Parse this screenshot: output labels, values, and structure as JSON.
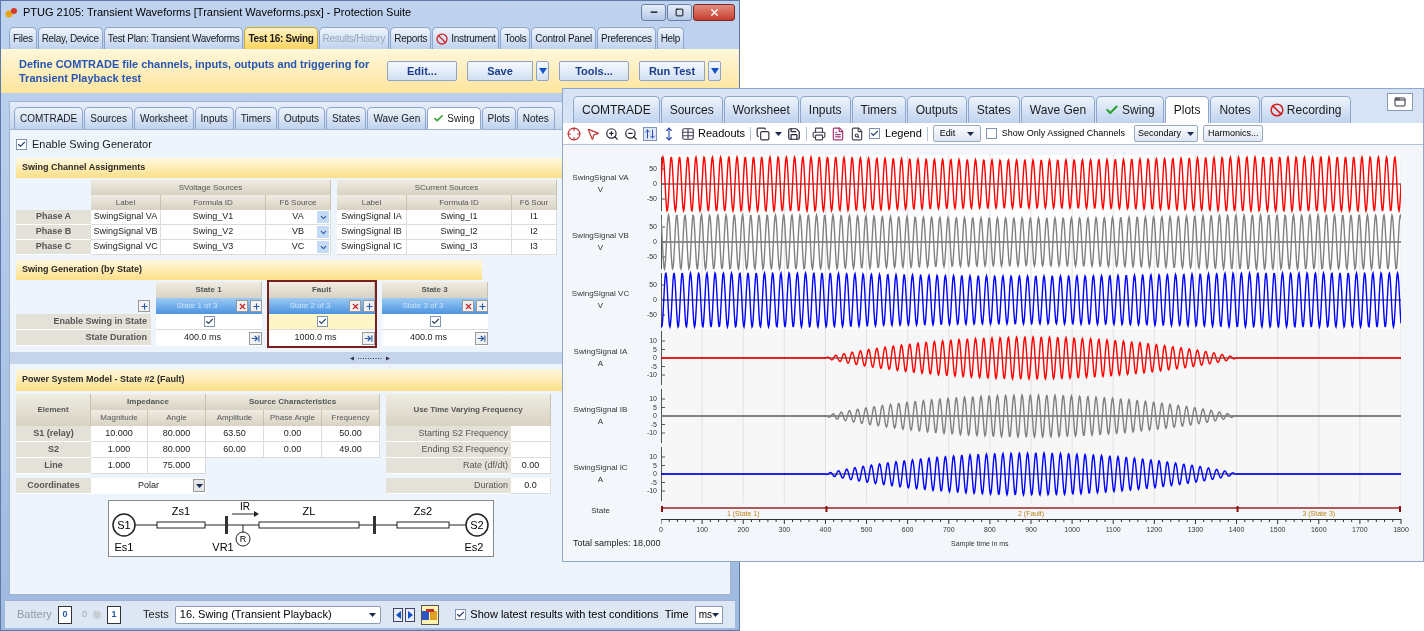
{
  "main_window": {
    "title": "PTUG 2105: Transient Waveforms [Transient Waveforms.psx] - Protection Suite",
    "tabs": [
      {
        "label": "Files",
        "kind": "plain",
        "selected": false,
        "disabled": false
      },
      {
        "label": "Relay, Device",
        "kind": "plain",
        "selected": false,
        "disabled": false
      },
      {
        "label": "Test Plan: Transient Waveforms",
        "kind": "plain",
        "selected": false,
        "disabled": false
      },
      {
        "label": "Test 16:  Swing",
        "kind": "plain",
        "selected": true,
        "disabled": false
      },
      {
        "label": "Results/History",
        "kind": "plain",
        "selected": false,
        "disabled": true
      },
      {
        "label": "Reports",
        "kind": "plain",
        "selected": false,
        "disabled": false
      },
      {
        "label": "Instrument",
        "kind": "blocked",
        "selected": false,
        "disabled": false
      },
      {
        "label": "Tools",
        "kind": "plain",
        "selected": false,
        "disabled": false
      },
      {
        "label": "Control Panel",
        "kind": "plain",
        "selected": false,
        "disabled": false
      },
      {
        "label": "Preferences",
        "kind": "plain",
        "selected": false,
        "disabled": false
      },
      {
        "label": "Help",
        "kind": "plain",
        "selected": false,
        "disabled": false
      }
    ],
    "instruction": "Define COMTRADE file channels, inputs, outputs and triggering for Transient Playback test",
    "buttons": [
      {
        "label": "Edit...",
        "dropdown": false
      },
      {
        "label": "Save",
        "dropdown": true
      },
      {
        "label": "Tools...",
        "dropdown": false
      },
      {
        "label": "Run Test",
        "dropdown": true
      }
    ]
  },
  "test_panel": {
    "tabs": [
      {
        "label": "COMTRADE",
        "kind": "plain",
        "selected": false
      },
      {
        "label": "Sources",
        "kind": "plain",
        "selected": false
      },
      {
        "label": "Worksheet",
        "kind": "plain",
        "selected": false
      },
      {
        "label": "Inputs",
        "kind": "plain",
        "selected": false
      },
      {
        "label": "Timers",
        "kind": "plain",
        "selected": false
      },
      {
        "label": "Outputs",
        "kind": "plain",
        "selected": false
      },
      {
        "label": "States",
        "kind": "plain",
        "selected": false
      },
      {
        "label": "Wave Gen",
        "kind": "plain",
        "selected": false
      },
      {
        "label": "Swing",
        "kind": "check",
        "selected": true
      },
      {
        "label": "Plots",
        "kind": "plain",
        "selected": false
      },
      {
        "label": "Notes",
        "kind": "plain",
        "selected": false
      }
    ],
    "enable_swing": {
      "label": "Enable Swing Generator",
      "checked": true
    },
    "channel_assignments": {
      "title": "Swing Channel Assignments",
      "groups": [
        "SVoltage Sources",
        "SCurrent Sources"
      ],
      "columns": [
        "Label",
        "Formula ID",
        "F6 Source",
        "Label",
        "Formula ID",
        "F6 Sour"
      ],
      "rows": [
        {
          "phase": "Phase A",
          "cells": [
            "SwingSignal VA",
            "Swing_V1",
            "VA",
            "SwingSignal IA",
            "Swing_I1",
            "I1"
          ]
        },
        {
          "phase": "Phase B",
          "cells": [
            "SwingSignal VB",
            "Swing_V2",
            "VB",
            "SwingSignal IB",
            "Swing_I2",
            "I2"
          ]
        },
        {
          "phase": "Phase C",
          "cells": [
            "SwingSignal VC",
            "Swing_V3",
            "VC",
            "SwingSignal IC",
            "Swing_I3",
            "I3"
          ]
        }
      ]
    },
    "swing_generation": {
      "title": "Swing Generation (by State)",
      "row_labels": [
        "Enable Swing in State",
        "State Duration"
      ],
      "states": [
        {
          "name": "State 1",
          "caption": "State 1 of 3",
          "enabled": true,
          "duration": "400.0 ms",
          "selected": false
        },
        {
          "name": "Fault",
          "caption": "State 2 of 3",
          "enabled": true,
          "duration": "1000.0 ms",
          "selected": true
        },
        {
          "name": "State 3",
          "caption": "State 3 of 3",
          "enabled": true,
          "duration": "400.0 ms",
          "selected": false
        }
      ]
    },
    "power_model": {
      "title": "Power System Model - State #2 (Fault)",
      "element_header": "Element",
      "groups": [
        "Impedance",
        "Source Characteristics"
      ],
      "columns": [
        "Magnitude",
        "Angle",
        "Amplitude",
        "Phase Angle",
        "Frequency"
      ],
      "rows": [
        {
          "element": "S1 (relay)",
          "values": [
            "10.000",
            "80.000",
            "63.50",
            "0.00",
            "50.00"
          ]
        },
        {
          "element": "S2",
          "values": [
            "1.000",
            "80.000",
            "60.00",
            "0.00",
            "49.00"
          ]
        },
        {
          "element": "Line",
          "values": [
            "1.000",
            "75.000"
          ]
        }
      ],
      "coordinates": {
        "label": "Coordinates",
        "value": "Polar"
      },
      "frequency": {
        "title": "Use Time Varying Frequency",
        "rows": [
          {
            "label": "Starting S2 Frequency"
          },
          {
            "label": "Ending S2 Frequency"
          },
          {
            "label": "Rate (df/dt)",
            "value": "0.00"
          },
          {
            "label": "Duration",
            "value": "0.0"
          }
        ]
      }
    },
    "diagram": {
      "s1": "S1",
      "zs1": "Zs1",
      "ir": "IR",
      "zl": "ZL",
      "zs2": "Zs2",
      "s2": "S2",
      "es1": "Es1",
      "vr1": "VR1",
      "r": "R",
      "es2": "Es2"
    }
  },
  "status_bar": {
    "battery_label": "Battery",
    "battery_value": "0",
    "count": "0",
    "box_value": "1",
    "tests_label": "Tests",
    "test_select": "16. Swing (Transient Playback)",
    "show_latest": {
      "label": "Show latest results with test conditions",
      "checked": true
    },
    "time_label": "Time",
    "time_unit": "ms"
  },
  "plot_window": {
    "tabs": [
      {
        "label": "COMTRADE",
        "kind": "plain",
        "selected": false
      },
      {
        "label": "Sources",
        "kind": "plain",
        "selected": false
      },
      {
        "label": "Worksheet",
        "kind": "plain",
        "selected": false
      },
      {
        "label": "Inputs",
        "kind": "plain",
        "selected": false
      },
      {
        "label": "Timers",
        "kind": "plain",
        "selected": false
      },
      {
        "label": "Outputs",
        "kind": "plain",
        "selected": false
      },
      {
        "label": "States",
        "kind": "plain",
        "selected": false
      },
      {
        "label": "Wave Gen",
        "kind": "plain",
        "selected": false
      },
      {
        "label": "Swing",
        "kind": "check",
        "selected": false
      },
      {
        "label": "Plots",
        "kind": "plain",
        "selected": true
      },
      {
        "label": "Notes",
        "kind": "plain",
        "selected": false
      },
      {
        "label": "Recording",
        "kind": "blocked",
        "selected": false
      }
    ],
    "toolbar": {
      "readouts": "Readouts",
      "legend": {
        "label": "Legend",
        "checked": true
      },
      "edit": "Edit",
      "assigned_only": {
        "label": "Show Only Assigned Channels",
        "checked": false
      },
      "mode": "Secondary",
      "harmonics": "Harmonics..."
    },
    "channels": [
      {
        "label": "SwingSignal VA",
        "unit": "V",
        "kind": "voltage",
        "color": "#ff0000",
        "ticks": [
          "50",
          "0",
          "-50"
        ]
      },
      {
        "label": "SwingSignal VB",
        "unit": "V",
        "kind": "voltage",
        "color": "#808080",
        "ticks": [
          "50",
          "0",
          "-50"
        ]
      },
      {
        "label": "SwingSignal VC",
        "unit": "V",
        "kind": "voltage",
        "color": "#0000ff",
        "ticks": [
          "50",
          "0",
          "-50"
        ]
      },
      {
        "label": "SwingSignal IA",
        "unit": "A",
        "kind": "current",
        "color": "#ff0000",
        "ticks": [
          "10",
          "5",
          "0",
          "-5",
          "-10"
        ]
      },
      {
        "label": "SwingSignal IB",
        "unit": "A",
        "kind": "current",
        "color": "#808080",
        "ticks": [
          "10",
          "5",
          "0",
          "-5",
          "-10"
        ]
      },
      {
        "label": "SwingSignal IC",
        "unit": "A",
        "kind": "current",
        "color": "#0000ff",
        "ticks": [
          "10",
          "5",
          "0",
          "-5",
          "-10"
        ]
      }
    ],
    "state_row": {
      "label": "State",
      "segments": [
        "1 (State 1)",
        "2 (Fault)",
        "3 (State 3)"
      ]
    },
    "x_ticks": [
      "0",
      "100",
      "200",
      "300",
      "400",
      "500",
      "600",
      "700",
      "800",
      "900",
      "1000",
      "1100",
      "1200",
      "1300",
      "1400",
      "1500",
      "1600",
      "1700",
      "1800"
    ],
    "x_label": "Sample time in ms",
    "total_samples": "Total samples: 18,000"
  }
}
